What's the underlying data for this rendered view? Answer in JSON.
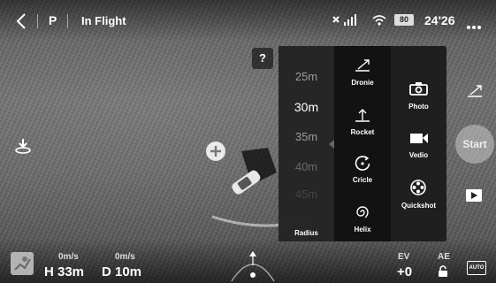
{
  "topbar": {
    "back_icon": "chevron-left-icon",
    "mode": "P",
    "status": "In Flight",
    "battery_level": "80",
    "flight_time": "24'26",
    "more_icon": "ellipsis-icon"
  },
  "help_label": "?",
  "radius_panel": {
    "options": [
      "25m",
      "30m",
      "35m",
      "40m",
      "45m"
    ],
    "selected": "30m",
    "label": "Radius"
  },
  "modes": [
    {
      "label": "Dronie",
      "icon": "dronie-icon"
    },
    {
      "label": "Rocket",
      "icon": "rocket-icon"
    },
    {
      "label": "Cricle",
      "icon": "circle-mode-icon"
    },
    {
      "label": "Helix",
      "icon": "helix-icon"
    }
  ],
  "shooting": [
    {
      "label": "Photo",
      "icon": "camera-icon"
    },
    {
      "label": "Vedio",
      "icon": "video-icon"
    },
    {
      "label": "Quickshot",
      "icon": "film-reel-icon"
    }
  ],
  "start_label": "Start",
  "telemetry": {
    "h_speed": "0m/s",
    "height": "H 33m",
    "v_speed": "0m/s",
    "distance": "D 10m"
  },
  "exposure": {
    "ev_label": "EV",
    "ev_value": "+0",
    "ae_label": "AE"
  },
  "colors": {
    "panel_bg": "#141414",
    "accent": "#ffffff"
  }
}
